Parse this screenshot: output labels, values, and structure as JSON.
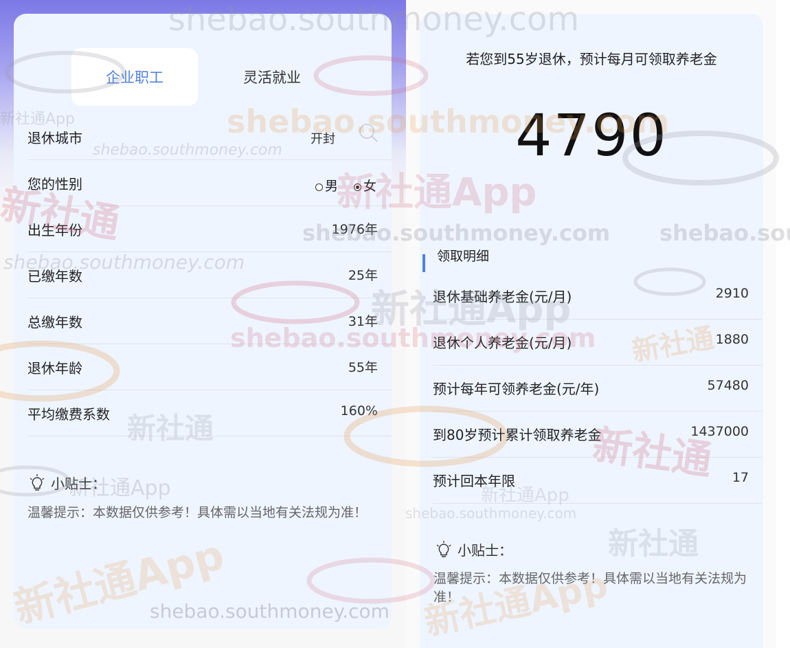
{
  "tabs": {
    "active": "企业职工",
    "inactive": "灵活就业"
  },
  "form": {
    "city": {
      "label": "退休城市",
      "value": "开封"
    },
    "gender": {
      "label": "您的性别",
      "male": "男",
      "female": "女",
      "selected": "女"
    },
    "birth_year": {
      "label": "出生年份",
      "value": "1976年"
    },
    "paid_years": {
      "label": "已缴年数",
      "value": "25年"
    },
    "total_years": {
      "label": "总缴年数",
      "value": "31年"
    },
    "retire_age": {
      "label": "退休年龄",
      "value": "55年"
    },
    "avg_ratio": {
      "label": "平均缴费系数",
      "value": "160%"
    }
  },
  "tip_left": {
    "title": "小贴士：",
    "text": "温馨提示：本数据仅供参考！具体需以当地有关法规为准！"
  },
  "result": {
    "headline": "若您到55岁退休，预计每月可领取养老金",
    "amount": "4790",
    "section_title": "领取明细",
    "rows": [
      {
        "label": "退休基础养老金(元/月)",
        "value": "2910"
      },
      {
        "label": "退休个人养老金(元/月)",
        "value": "1880"
      },
      {
        "label": "预计每年可领养老金(元/年)",
        "value": "57480"
      },
      {
        "label": "到80岁预计累计领取养老金",
        "value": "1437000"
      },
      {
        "label": "预计回本年限",
        "value": "17"
      }
    ]
  },
  "tip_right": {
    "title": "小贴士：",
    "text": "温馨提示：本数据仅供参考！具体需以当地有关法规为准！"
  },
  "watermarks": {
    "domain": "shebao.southmoney.com",
    "app": "新社通App",
    "brand": "新社通"
  },
  "colors": {
    "accent": "#4f7fe0",
    "card": "#eef5ff",
    "header_gradient_top": "#7b78e6"
  }
}
